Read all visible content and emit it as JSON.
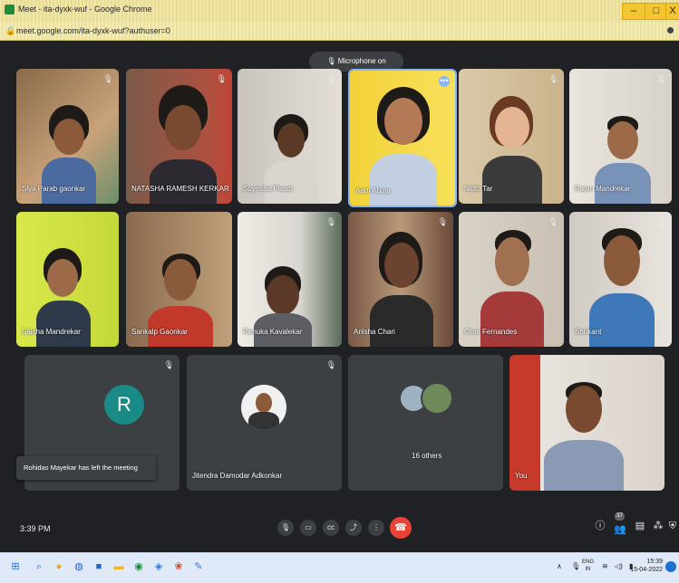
{
  "window": {
    "title": "Meet - ita-dyxk-wuf - Google Chrome",
    "minimize": "–",
    "maximize": "□",
    "close": "X"
  },
  "address": {
    "url": "meet.google.com/ita-dyxk-wuf?authuser=0"
  },
  "banner": {
    "label": "Microphone on"
  },
  "tiles": [
    {
      "name": "Siya Parab gaonkar"
    },
    {
      "name": "NATASHA RAMESH KERKAR"
    },
    {
      "name": "Suyesha Parab"
    },
    {
      "name": "Aarti Ahuja"
    },
    {
      "name": "Nidhi Tar"
    },
    {
      "name": "Rajan Mandrekar"
    },
    {
      "name": "Saisha Mandrekar"
    },
    {
      "name": "Sankalp Gaonkar"
    },
    {
      "name": "Renuka Kavalekar"
    },
    {
      "name": "Anisha Chari"
    },
    {
      "name": "Clive Fernandes"
    },
    {
      "name": "Shrikant"
    },
    {
      "name": "",
      "initial": "R"
    },
    {
      "name": "Jitendra Damodar Adkonkar"
    },
    {
      "name": "16 others"
    },
    {
      "name": "You"
    }
  ],
  "toast": {
    "text": "Rohidas Mayekar has left the meeting"
  },
  "bottom": {
    "time": "3:39 PM",
    "participants_count": "37"
  },
  "taskbar": {
    "lang": "ENG",
    "region": "IN",
    "clock_time": "15:39",
    "clock_date": "15-04-2022"
  },
  "colors": {
    "accent_blue": "#8ab4f8",
    "end_call": "#ea4335",
    "avatar_teal": "#1a8a87"
  }
}
